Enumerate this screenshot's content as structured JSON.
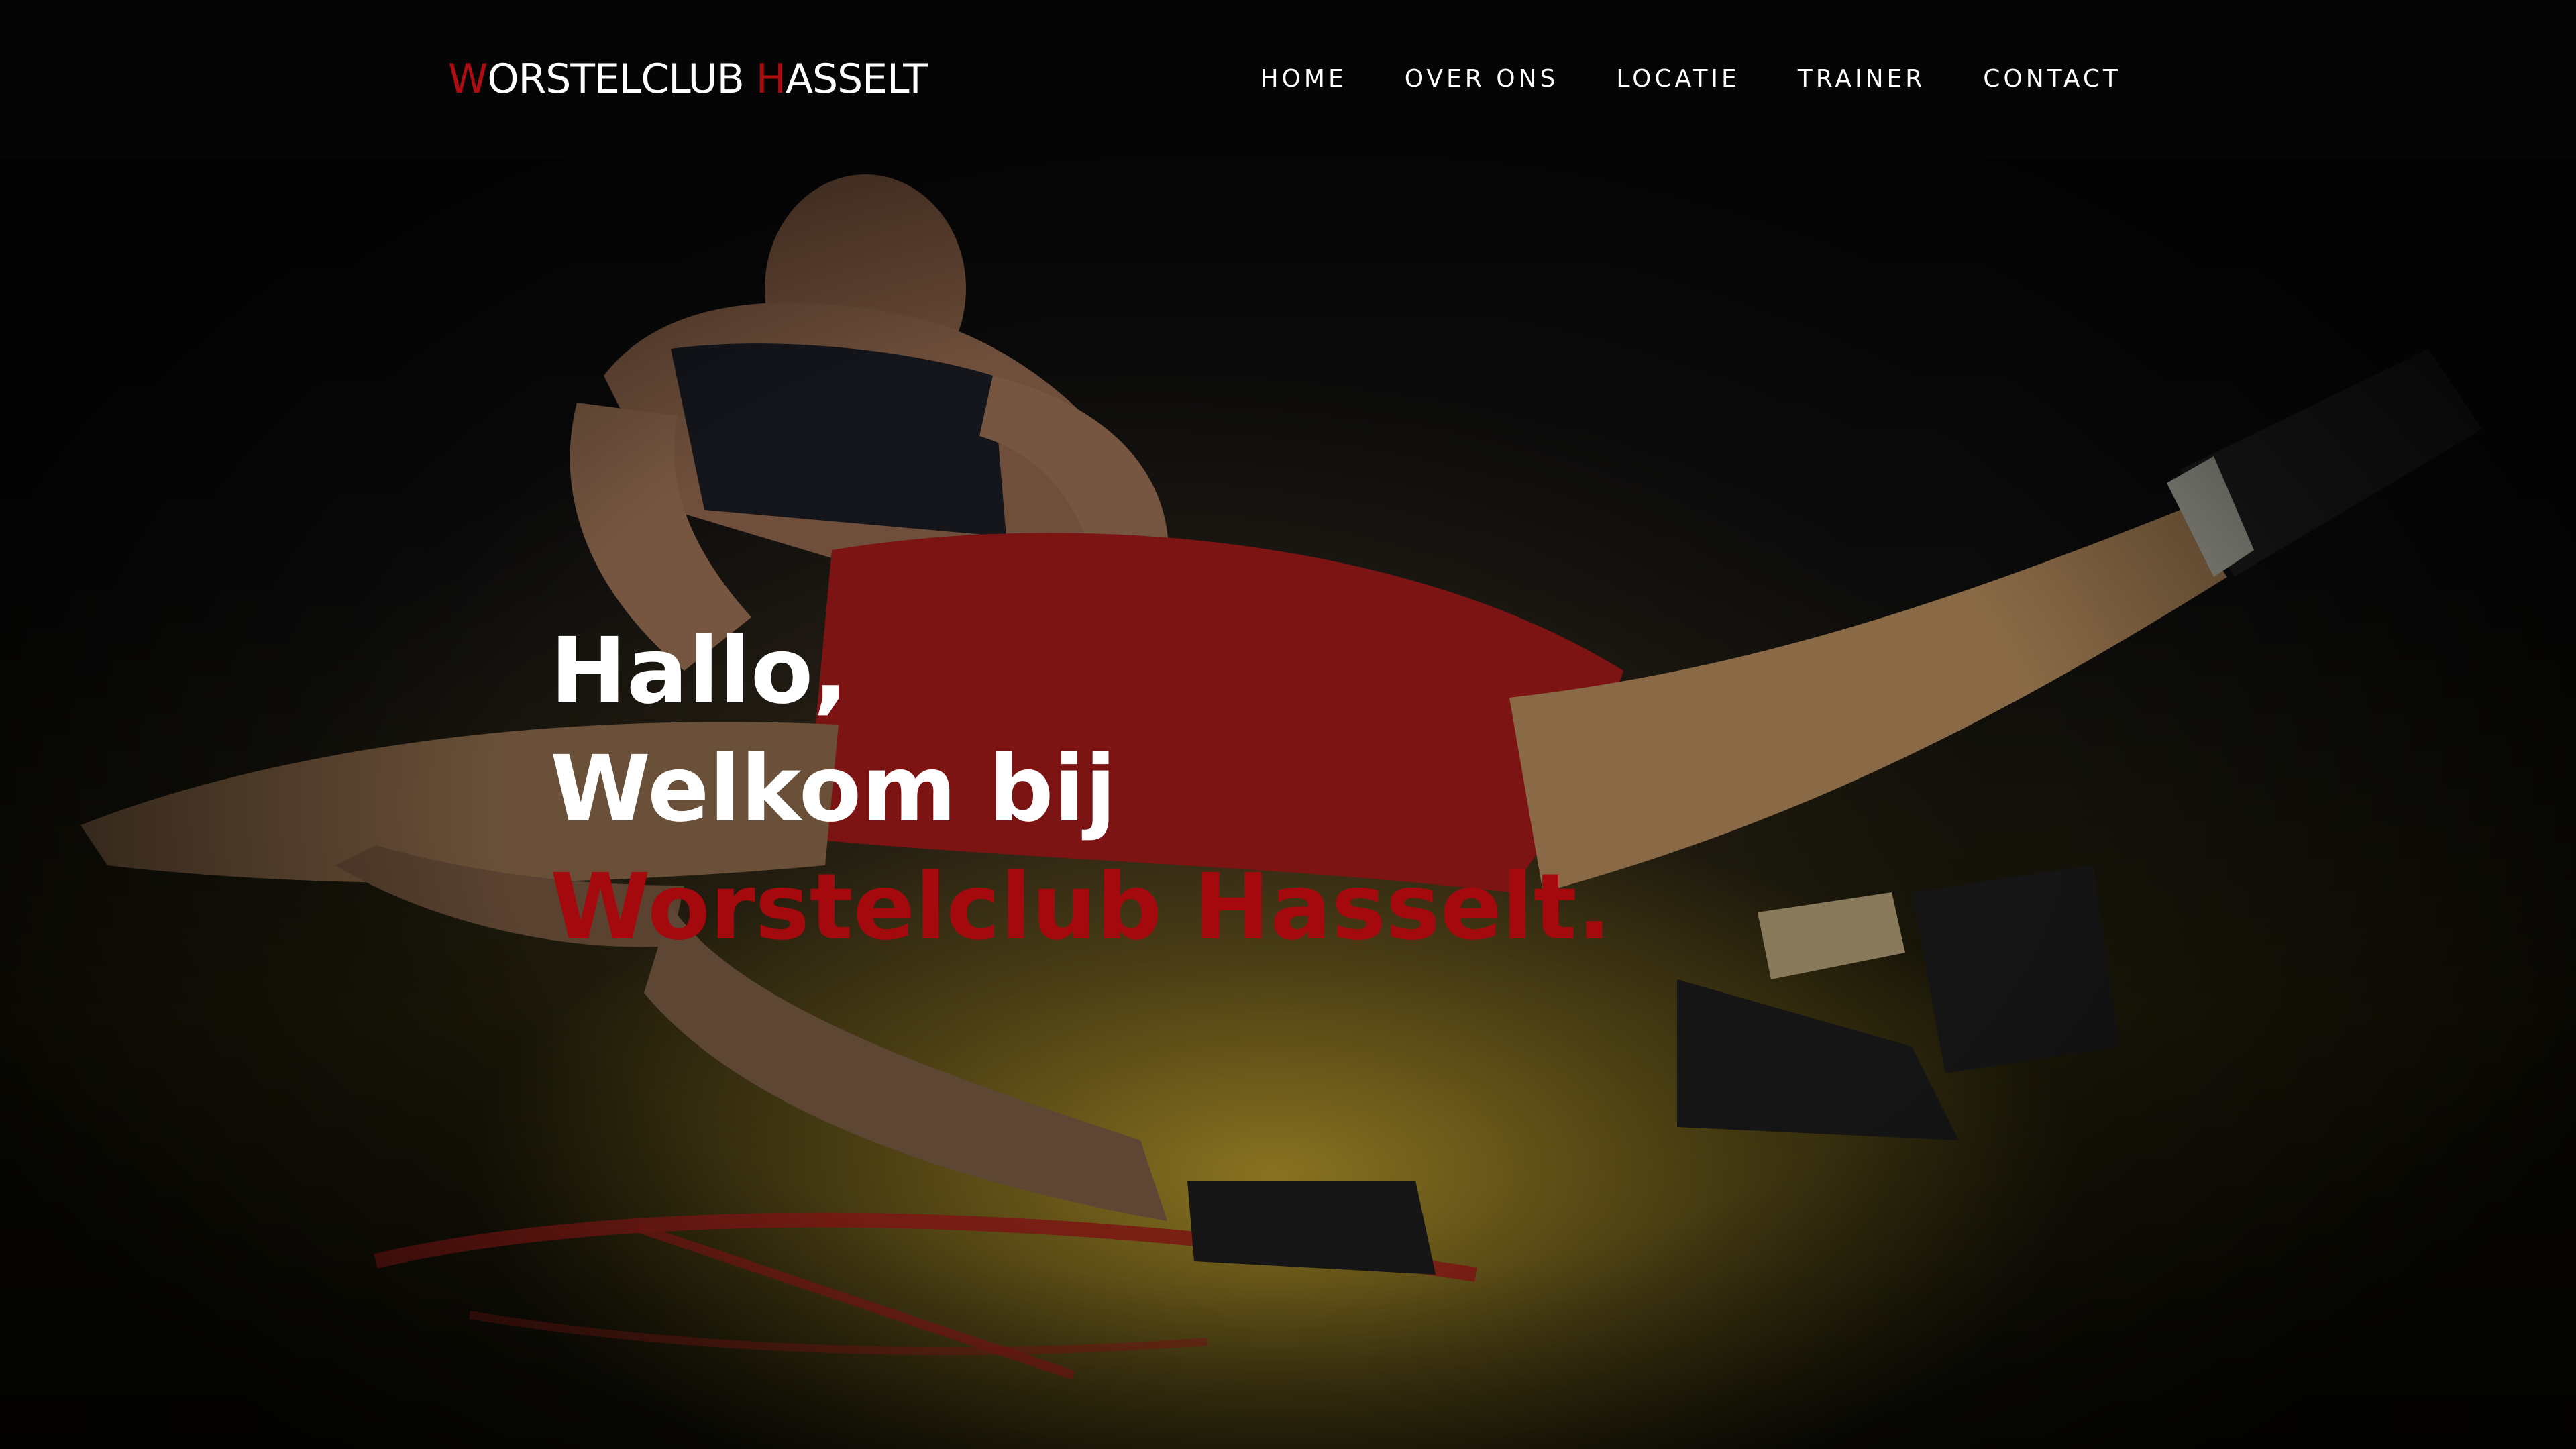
{
  "brand": {
    "logo_initial_1": "W",
    "logo_rest_1": "ORSTELCLUB",
    "logo_initial_2": "H",
    "logo_rest_2": "ASSELT",
    "accent_color": "#b00d12"
  },
  "nav": {
    "items": [
      {
        "label": "HOME"
      },
      {
        "label": "OVER ONS"
      },
      {
        "label": "LOCATIE"
      },
      {
        "label": "TRAINER"
      },
      {
        "label": "CONTACT"
      }
    ]
  },
  "hero": {
    "line_1": "Hallo,",
    "line_2": "Welkom bij",
    "line_3": "Worstelclub Hasselt.",
    "background_image": "wrestling-match-photo"
  }
}
